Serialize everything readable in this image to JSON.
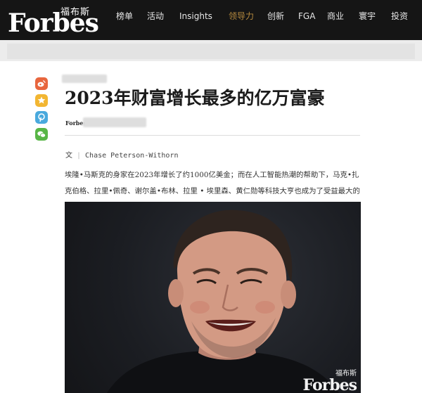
{
  "brand": {
    "logo_cn": "福布斯",
    "logo_en": "Forbes"
  },
  "nav": {
    "items": [
      {
        "label": "榜单",
        "active": false
      },
      {
        "label": "活动",
        "active": false
      },
      {
        "label": "Insights",
        "active": false
      },
      {
        "label": "领导力",
        "active": true
      },
      {
        "label": "创新",
        "active": false
      },
      {
        "label": "FGA",
        "active": false
      },
      {
        "label": "商业",
        "active": false
      },
      {
        "label": "寰宇",
        "active": false
      },
      {
        "label": "投资",
        "active": false
      }
    ],
    "active_color": "#b68a3e"
  },
  "share": {
    "icons": [
      "weibo-icon",
      "star-icon",
      "pinterest-icon",
      "wechat-icon"
    ]
  },
  "article": {
    "title": "2023年财富增长最多的亿万富豪",
    "source_logo": "Forbes",
    "byline_prefix": "文",
    "author": "Chase Peterson-Withorn",
    "summary": "埃隆•马斯克的身家在2023年增长了约1000亿美金；而在人工智能热潮的帮助下，马克•扎克伯格、拉里•佩奇、谢尔盖•布林、拉里 • 埃里森、黄仁勋等科技大亨也成为了受益最大的群体。",
    "image_watermark_cn": "福布斯",
    "image_watermark_en": "Forbes"
  }
}
